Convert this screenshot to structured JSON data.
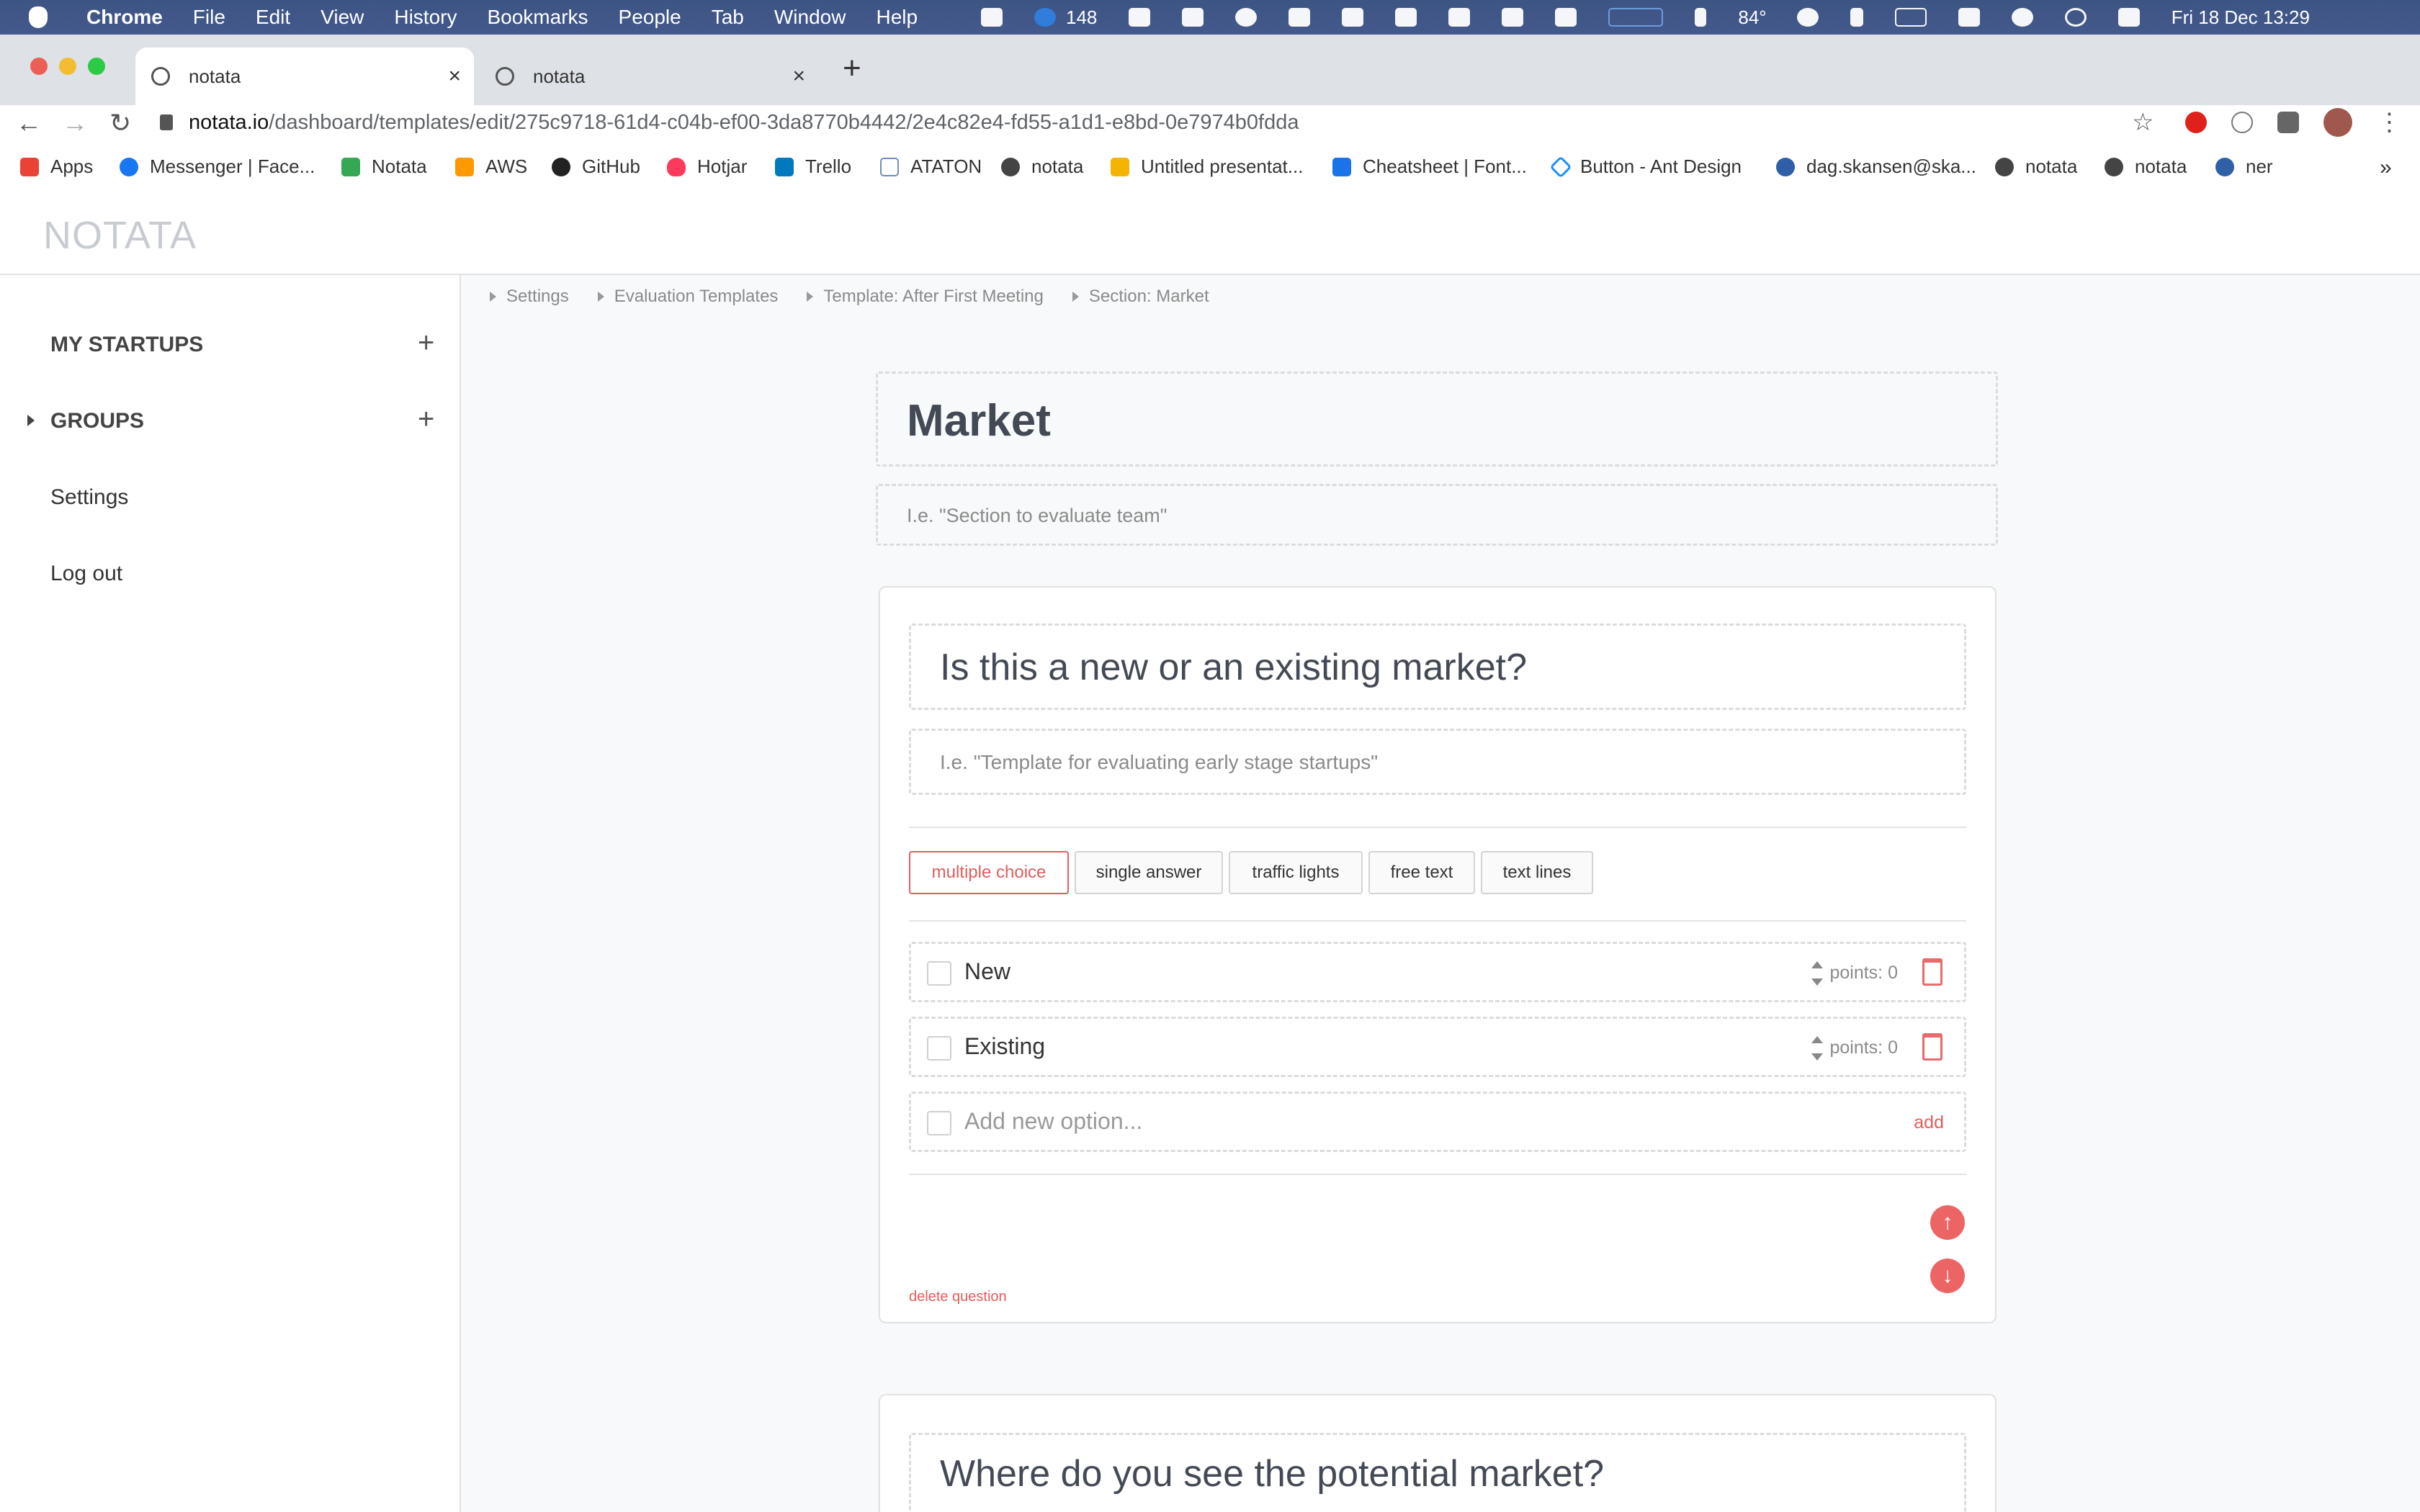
{
  "menubar": {
    "app": "Chrome",
    "items": [
      "File",
      "Edit",
      "View",
      "History",
      "Bookmarks",
      "People",
      "Tab",
      "Window",
      "Help"
    ],
    "badge_count": "148",
    "temperature": "84°",
    "datetime": "Fri 18 Dec  13:29"
  },
  "tabs": [
    {
      "label": "notata"
    },
    {
      "label": "notata"
    }
  ],
  "url": {
    "host": "notata.io",
    "path": "/dashboard/templates/edit/275c9718-61d4-c04b-ef00-3da8770b4442/2e4c82e4-fd55-a1d1-e8bd-0e7974b0fdda"
  },
  "bookmarks": [
    {
      "label": "Apps",
      "color": "#ea4335"
    },
    {
      "label": "Messenger | Face...",
      "color": "#1877f2"
    },
    {
      "label": "Notata",
      "color": "#34a853"
    },
    {
      "label": "AWS",
      "color": "#ff9900"
    },
    {
      "label": "GitHub",
      "color": "#222222"
    },
    {
      "label": "Hotjar",
      "color": "#fd3a5c"
    },
    {
      "label": "Trello",
      "color": "#0079bf"
    },
    {
      "label": "ATATON",
      "color": "#6c8ebf"
    },
    {
      "label": "notata",
      "color": "#444444"
    },
    {
      "label": "Untitled presentat...",
      "color": "#f4b400"
    },
    {
      "label": "Cheatsheet | Font...",
      "color": "#1a73e8"
    },
    {
      "label": "Button - Ant Design",
      "color": "#1890ff"
    },
    {
      "label": "dag.skansen@ska...",
      "color": "#2f5fa7"
    },
    {
      "label": "notata",
      "color": "#444444"
    },
    {
      "label": "notata",
      "color": "#444444"
    },
    {
      "label": "ner",
      "color": "#2f5fa7"
    }
  ],
  "sidebar": {
    "logo": "NOTATA",
    "items": [
      {
        "label": "MY STARTUPS"
      },
      {
        "label": "GROUPS"
      },
      {
        "label": "Settings"
      },
      {
        "label": "Log out"
      }
    ]
  },
  "breadcrumb": [
    "Settings",
    "Evaluation Templates",
    "Template: After First Meeting",
    "Section: Market"
  ],
  "section": {
    "title": "Market",
    "description_placeholder": "I.e. \"Section to evaluate team\""
  },
  "question": {
    "title": "Is this a new or an existing market?",
    "description_placeholder": "I.e. \"Template for evaluating early stage startups\"",
    "types": [
      "multiple choice",
      "single answer",
      "traffic lights",
      "free text",
      "text lines"
    ],
    "active_type": "multiple choice",
    "options": [
      {
        "label": "New",
        "points_label": "points:",
        "points": "0"
      },
      {
        "label": "Existing",
        "points_label": "points:",
        "points": "0"
      }
    ],
    "new_option_placeholder": "Add new option...",
    "add_label": "add",
    "delete_label": "delete question"
  },
  "next_question": {
    "title": "Where do you see the potential market?"
  },
  "colors": {
    "accent": "#e05d5d",
    "menubar": "#3c5583"
  }
}
